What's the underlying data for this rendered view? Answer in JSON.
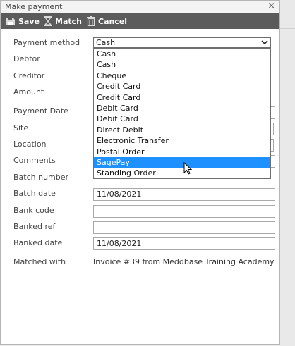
{
  "dialog": {
    "title": "Make payment",
    "close_glyph": "×"
  },
  "toolbar": {
    "save_label": "Save",
    "match_label": "Match",
    "cancel_label": "Cancel"
  },
  "form": {
    "payment_method_label": "Payment method",
    "payment_method_value": "Cash",
    "debtor_label": "Debtor",
    "creditor_label": "Creditor",
    "amount_label": "Amount",
    "payment_date_label": "Payment Date",
    "site_label": "Site",
    "location_label": "Location",
    "comments_label": "Comments",
    "batch_number_label": "Batch number",
    "batch_date_label": "Batch date",
    "batch_date_value": "11/08/2021",
    "bank_code_label": "Bank code",
    "bank_code_value": "",
    "banked_ref_label": "Banked ref",
    "banked_ref_value": "",
    "banked_date_label": "Banked date",
    "banked_date_value": "11/08/2021",
    "matched_with_label": "Matched with",
    "matched_with_value": "Invoice #39 from Meddbase Training Academy"
  },
  "dropdown": {
    "options": [
      "Cash",
      "Cash",
      "Cheque",
      "Credit Card",
      "Credit Card",
      "Debit Card",
      "Debit Card",
      "Direct Debit",
      "Electronic Transfer",
      "Postal Order",
      "SagePay",
      "Standing Order"
    ],
    "highlighted": "SagePay"
  },
  "icons": {
    "save": "floppy-disk-icon",
    "match": "hourglass-icon",
    "cancel": "trash-icon",
    "chevron": "chevron-down-icon",
    "pointer": "mouse-pointer-icon"
  },
  "colors": {
    "toolbar_bg": "#5b5b5b",
    "highlight": "#1e90ff"
  }
}
